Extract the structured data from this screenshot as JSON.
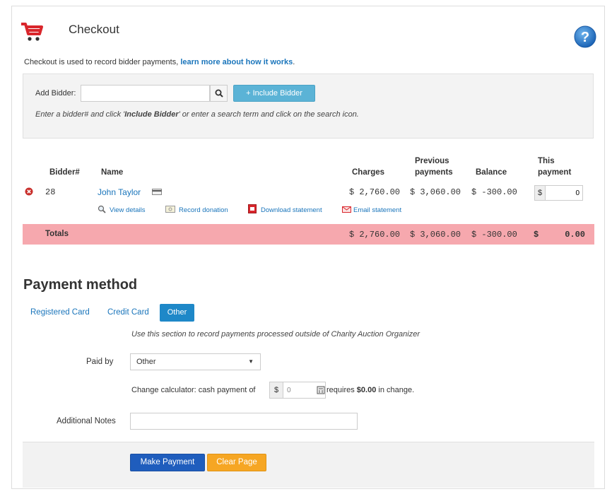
{
  "header": {
    "title": "Checkout",
    "intro_text": "Checkout is used to record bidder payments, ",
    "intro_link": "learn more about how it works",
    "intro_end": "."
  },
  "add_bidder": {
    "label": "Add Bidder:",
    "input_value": "",
    "include_button": "+ Include Bidder",
    "hint_pre": "Enter a bidder# and click '",
    "hint_bold": "Include Bidder",
    "hint_post": "' or enter a search term and click on the search icon."
  },
  "table": {
    "headers": {
      "bidder": "Bidder#",
      "name": "Name",
      "charges": "Charges",
      "previous_line1": "Previous",
      "previous_line2": "payments",
      "balance": "Balance",
      "this_line1": "This",
      "this_line2": "payment"
    },
    "row": {
      "bidder": "28",
      "name": "John Taylor",
      "charges": "$  2,760.00",
      "previous": "$  3,060.00",
      "balance": "$   -300.00",
      "currency": "$",
      "this_payment": "0"
    },
    "actions": {
      "view": "View details",
      "donation": "Record donation",
      "download": "Download statement",
      "email": "Email statement"
    },
    "totals": {
      "label": "Totals",
      "charges": "$  2,760.00",
      "previous": "$  3,060.00",
      "balance": "$   -300.00",
      "this_payment_sign": "$",
      "this_payment": "0.00"
    }
  },
  "payment": {
    "heading": "Payment method",
    "tabs": [
      "Registered Card",
      "Credit Card",
      "Other"
    ],
    "active_tab": "Other",
    "note": "Use this section to record payments processed outside of Charity Auction Organizer",
    "paid_by_label": "Paid by",
    "paid_by_value": "Other",
    "calc_pre": "Change calculator: cash payment of",
    "calc_currency": "$",
    "calc_value": "0",
    "calc_mid": " requires ",
    "calc_amount": "$0.00",
    "calc_post": " in change.",
    "notes_label": "Additional Notes",
    "notes_value": ""
  },
  "buttons": {
    "make_payment": "Make Payment",
    "clear_page": "Clear Page"
  },
  "colors": {
    "accent": "#1a75bb",
    "totals_bg": "#f6a8ae",
    "pay_button": "#1f5dbd",
    "clear_button": "#f6a623"
  }
}
